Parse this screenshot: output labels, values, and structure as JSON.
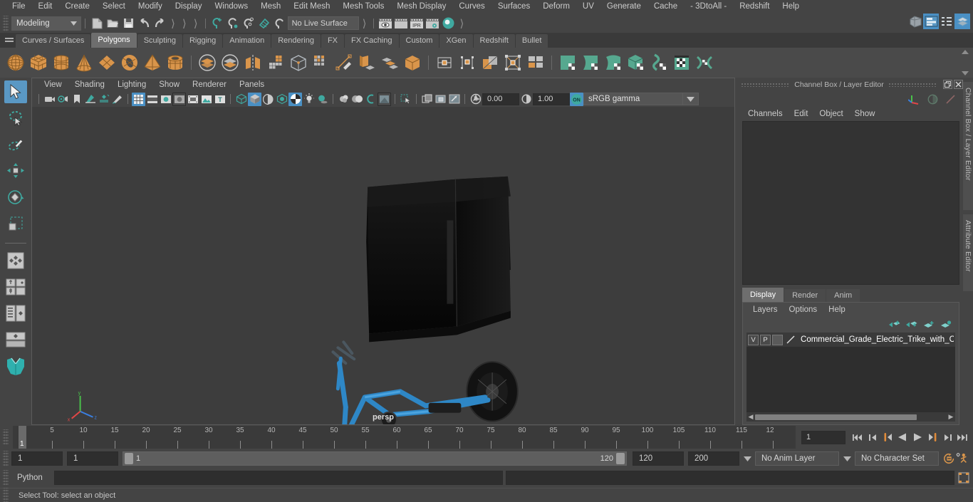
{
  "menubar": {
    "items": [
      "File",
      "Edit",
      "Create",
      "Select",
      "Modify",
      "Display",
      "Windows",
      "Mesh",
      "Edit Mesh",
      "Mesh Tools",
      "Mesh Display",
      "Curves",
      "Surfaces",
      "Deform",
      "UV",
      "Generate",
      "Cache",
      "- 3DtoAll -",
      "Redshift",
      "Help"
    ],
    "right_icons": [
      "modeling-toolkit-icon",
      "attribute-editor-icon",
      "outliner-icon",
      "channel-box-icon"
    ]
  },
  "statusline": {
    "mode": "Modeling",
    "live_surface": "No Live Surface",
    "icons": [
      "new-scene-icon",
      "open-scene-icon",
      "save-scene-icon",
      "undo-icon",
      "redo-icon",
      "select-by-hierarchy-icon",
      "select-by-object-icon",
      "select-by-component-icon",
      "snap-to-grid-icon",
      "snap-to-curve-icon",
      "snap-to-point-icon",
      "snap-to-projected-center-icon",
      "snap-to-view-plane-icon",
      "render-view-icon",
      "render-sequence-icon",
      "ipr-render-icon",
      "render-settings-icon",
      "hypershade-icon"
    ]
  },
  "shelf": {
    "tabs": [
      "Curves / Surfaces",
      "Polygons",
      "Sculpting",
      "Rigging",
      "Animation",
      "Rendering",
      "FX",
      "FX Caching",
      "Custom",
      "XGen",
      "Redshift",
      "Bullet"
    ],
    "active_tab": "Polygons",
    "icons": [
      "poly-sphere-icon",
      "poly-cube-icon",
      "poly-cylinder-icon",
      "poly-cone-icon",
      "poly-plane-icon",
      "poly-torus-icon",
      "poly-pyramid-icon",
      "poly-pipe-icon",
      "boolean-union-icon",
      "boolean-difference-icon",
      "combine-icon",
      "smooth-icon",
      "mirror-icon",
      "multi-cut-icon",
      "quad-draw-icon",
      "extrude-icon",
      "bevel-icon",
      "merge-icon",
      "vertex-edit-icon",
      "edge-edit-icon",
      "face-edit-icon",
      "uv-edit-icon",
      "component-grid-icon",
      "sculpt-grab-icon",
      "sculpt-smooth-icon",
      "sculpt-relax-icon",
      "sculpt-pinch-icon",
      "sculpt-flatten-icon",
      "sculpt-mask-icon",
      "sculpt-foamy-icon"
    ]
  },
  "toolbox": {
    "items": [
      "select-tool",
      "lasso-select-tool",
      "paint-select-tool",
      "move-tool",
      "rotate-tool",
      "scale-tool",
      "last-tool-used",
      "snap-grid-toggle",
      "layout-quad-icon",
      "layout-list-icon",
      "layout-single-icon",
      "maya-logo-icon"
    ],
    "active": "select-tool"
  },
  "viewport": {
    "menu": [
      "View",
      "Shading",
      "Lighting",
      "Show",
      "Renderer",
      "Panels"
    ],
    "camera_label": "persp",
    "exposure": "0.00",
    "gamma": "1.00",
    "color_management": "sRGB gamma",
    "toolbar_icons": [
      "select-camera-icon",
      "camera-attributes-icon",
      "bookmark-icon",
      "image-plane-icon",
      "two-sided-lighting-icon",
      "grease-pencil-icon",
      "grid-toggle-icon",
      "film-gate-icon",
      "resolution-gate-icon",
      "gate-mask-icon",
      "film-origin-icon",
      "image-plane-display-icon",
      "text-display-icon",
      "wireframe-icon",
      "smooth-shade-icon",
      "shaded-wireframe-icon",
      "textured-icon",
      "checker-texture-icon",
      "use-default-lighting-icon",
      "shadows-icon",
      "ambient-occlusion-icon",
      "motion-blur-icon",
      "multisample-icon",
      "isolate-select-icon",
      "xray-icon",
      "xray-joints-icon",
      "xray-active-components-icon",
      "exposure-icon",
      "gamma-icon",
      "color-management-toggle-icon"
    ],
    "active_icons": [
      "grid-toggle-icon",
      "smooth-shade-icon",
      "checker-texture-icon",
      "color-management-toggle-icon"
    ]
  },
  "channelbox": {
    "panel_title": "Channel Box / Layer Editor",
    "menu": [
      "Channels",
      "Edit",
      "Object",
      "Show"
    ],
    "icons": [
      "axis-gizmo-icon",
      "channel-circle-icon",
      "channel-slash-icon"
    ],
    "window_buttons": [
      "undock-icon",
      "close-icon"
    ]
  },
  "layereditor": {
    "tabs": [
      "Display",
      "Render",
      "Anim"
    ],
    "active_tab": "Display",
    "menu": [
      "Layers",
      "Options",
      "Help"
    ],
    "buttons": [
      "move-layer-up-icon",
      "move-layer-down-icon",
      "create-empty-layer-icon",
      "create-layer-from-selection-icon"
    ],
    "rows": [
      {
        "visibility": "V",
        "playback": "P",
        "shading": "",
        "color_swatch": "layer-color-icon",
        "name": "Commercial_Grade_Electric_Trike_with_Car"
      }
    ]
  },
  "side_tabs": [
    "Channel Box / Layer Editor",
    "Attribute Editor"
  ],
  "timeline": {
    "start_frame": "1",
    "end_frame": "120",
    "current_frame": "1",
    "playback_start": "1",
    "playback_end": "120",
    "animation_end": "200",
    "range_start": "1",
    "range_end": "120",
    "tick_labels": [
      "5",
      "10",
      "15",
      "20",
      "25",
      "30",
      "35",
      "40",
      "45",
      "50",
      "55",
      "60",
      "65",
      "70",
      "75",
      "80",
      "85",
      "90",
      "95",
      "100",
      "105",
      "110",
      "115",
      "12"
    ],
    "anim_layer": "No Anim Layer",
    "character_set": "No Character Set",
    "playback_icons": [
      "go-to-start-icon",
      "step-back-keyframe-icon",
      "step-back-frame-icon",
      "play-backwards-icon",
      "play-forwards-icon",
      "step-forward-frame-icon",
      "step-forward-keyframe-icon",
      "go-to-end-icon"
    ],
    "right_icons": [
      "animation-preferences-icon",
      "character-set-icon"
    ]
  },
  "command_line": {
    "language": "Python",
    "input_value": "",
    "output_value": "",
    "script-editor-icon": "script-editor-icon"
  },
  "statusbar": {
    "help_text": "Select Tool: select an object"
  },
  "colors": {
    "accent_blue": "#4a90c4",
    "shelf_orange": "#d9954b",
    "teal": "#3fa9a0",
    "panel_bg": "#444444",
    "viewport_bg": "#3d3d3d",
    "model_blue": "#2e87c6"
  }
}
